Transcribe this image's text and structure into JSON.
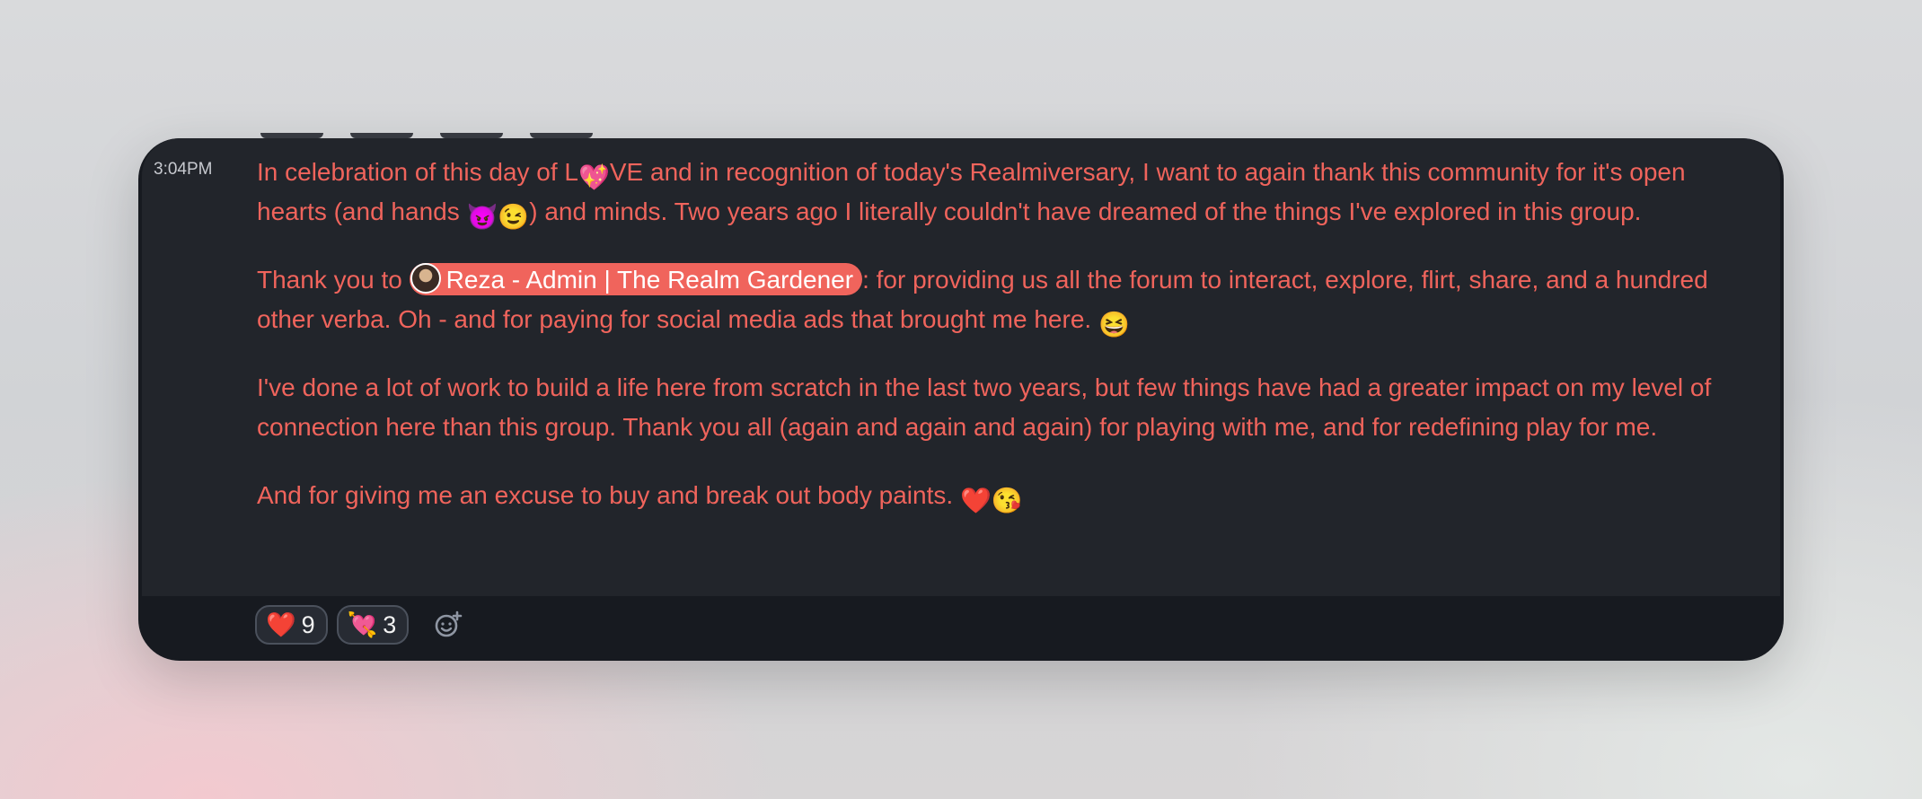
{
  "message": {
    "timestamp": "3:04PM",
    "p1": {
      "t1": "In celebration of this day of L",
      "e1": "💖",
      "t2": "VE and in recognition of today's Realmiversary, I want to again thank this community for it's open hearts (and hands ",
      "e2": "😈😉",
      "t3": ") and minds. Two years ago I literally couldn't have dreamed of the things I've explored in this group."
    },
    "p2": {
      "t1": "Thank you to ",
      "mention": "Reza - Admin | The Realm Gardener",
      "t2": ": for providing us all the forum to interact, explore, flirt, share, and a hundred other verba. Oh - and for paying for social media ads that brought me here. ",
      "e1": "😆"
    },
    "p3": "I've done a lot of work to build a life here from scratch in the last two years, but few things have had a greater impact on my level of connection here than this group. Thank you all (again and again and again) for playing with me, and for redefining play for me.",
    "p4": {
      "t1": "And for giving me an excuse to buy and break out body paints. ",
      "e1": "❤️😘"
    }
  },
  "reactions": [
    {
      "emoji": "❤️",
      "count": "9"
    },
    {
      "emoji": "💘",
      "count": "3"
    }
  ],
  "add_reaction_icon": "add-emoji-icon",
  "colors": {
    "accent": "#f0645c",
    "bg": "#22252b",
    "footer": "#171a20"
  }
}
